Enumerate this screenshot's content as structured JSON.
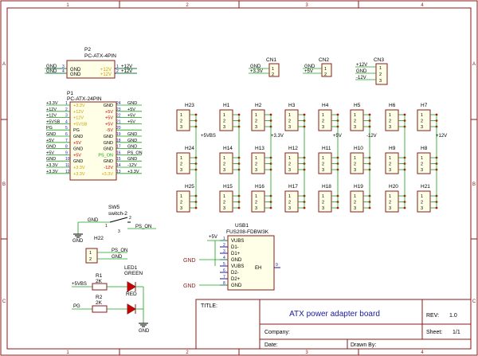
{
  "frame": {
    "col_labels": [
      "1",
      "2",
      "3",
      "4"
    ],
    "row_labels": [
      "A",
      "B",
      "C"
    ]
  },
  "title_block": {
    "title_label": "TITLE:",
    "title": "ATX power adapter board",
    "rev_label": "REV:",
    "rev": "1.0",
    "company_label": "Company:",
    "company": "",
    "sheet_label": "Sheet:",
    "sheet": "1/1",
    "date_label": "Date:",
    "date": "",
    "drawn_label": "Drawn By:",
    "drawn": ""
  },
  "p2": {
    "ref": "P2",
    "value": "PC-ATX-4PIN",
    "left_labels": [
      "GND",
      "GND"
    ],
    "right_labels": [
      "+12V",
      "+12V"
    ],
    "left_nets": [
      "GND",
      "GND"
    ],
    "right_nets": [
      "+12V",
      "+12V"
    ],
    "left_nums": [
      "3",
      "4"
    ],
    "right_nums": [
      "1",
      "2"
    ]
  },
  "p1": {
    "ref": "P1",
    "value": "PC-ATX-24PIN",
    "left_nums": [
      "1",
      "2",
      "3",
      "4",
      "5",
      "6",
      "7",
      "8",
      "9",
      "10",
      "11",
      "12"
    ],
    "right_nums": [
      "24",
      "23",
      "22",
      "21",
      "20",
      "19",
      "18",
      "17",
      "16",
      "15",
      "14",
      "13"
    ],
    "left_labels": [
      "+3.3V",
      "+12V",
      "+12V",
      "+5VSB",
      "PG",
      "GND",
      "+5V",
      "GND",
      "+5V",
      "GND",
      "+3.3V",
      "+3.3V"
    ],
    "right_labels": [
      "GND",
      "+5V",
      "+5V",
      "+5V",
      "-5V",
      "GND",
      "GND",
      "GND",
      "PS_ON",
      "GND",
      "-12V",
      "+3.3V"
    ],
    "left_nets": [
      "+3.3V",
      "+12V",
      "+12V",
      "+5VSB",
      "PG",
      "GND",
      "+5V",
      "GND",
      "+5V",
      "GND",
      "+3.3V",
      "+3.3V"
    ],
    "right_nets": [
      "GND",
      "+5V",
      "+5V",
      "+5V",
      "",
      "GND",
      "GND",
      "GND",
      "PS_ON",
      "GND",
      "-12V",
      "+3.3V"
    ]
  },
  "cn1": {
    "ref": "CN1",
    "pins": [
      "1",
      "2"
    ],
    "nets": [
      "GND",
      "+3.3V"
    ]
  },
  "cn2": {
    "ref": "CN2",
    "pins": [
      "1",
      "2"
    ],
    "nets": [
      "GND",
      "+5V"
    ]
  },
  "cn3": {
    "ref": "CN3",
    "pins": [
      "1",
      "2",
      "3"
    ],
    "nets": [
      "+12V",
      "GND",
      "-12V"
    ]
  },
  "headers": {
    "row1": [
      "H23",
      "H1",
      "H2",
      "H3",
      "H4",
      "H5",
      "H6",
      "H7"
    ],
    "row2": [
      "H24",
      "H14",
      "H13",
      "H12",
      "H11",
      "H10",
      "H9",
      "H8"
    ],
    "row3": [
      "H25",
      "H15",
      "H16",
      "H17",
      "H18",
      "H19",
      "H20",
      "H21"
    ],
    "pins": [
      "1",
      "2",
      "3"
    ]
  },
  "rail_labels": [
    "+5VBS",
    "+3.3V",
    "+5V",
    "-12V",
    "+12V"
  ],
  "sw5": {
    "ref": "SW5",
    "value": "switch-2",
    "net_left": "GND",
    "net_right": "PS_ON",
    "pins": [
      "1",
      "2",
      "3"
    ],
    "gnd": "GND"
  },
  "h22": {
    "ref": "H22",
    "nets": [
      "PS_ON",
      "GND"
    ],
    "pins": [
      "1",
      "2"
    ]
  },
  "leds": {
    "led1_ref": "LED1",
    "led1_value": "GREEN",
    "led2_value": "RED",
    "r1_ref": "R1",
    "r1_value": "2K",
    "r2_ref": "R2",
    "r2_value": "2K",
    "r1_net": "+5VBS",
    "r2_net": "PG",
    "gnd": "GND"
  },
  "usb1": {
    "ref": "USB1",
    "value": "FUS208-FDBW3K",
    "pins_left": [
      "VUBS",
      "D1-",
      "D1+",
      "GND",
      "VUBS",
      "D2-",
      "D2+",
      "GND"
    ],
    "pin_nums_left": [
      "1",
      "2",
      "3",
      "4",
      "5",
      "6",
      "7",
      "8"
    ],
    "pin_right": "EH",
    "pin_right_num": "9",
    "net": "+5V",
    "gnd_labels": [
      "GND",
      "GND"
    ]
  },
  "colors": {
    "frame": "#8b1a1a",
    "wire": "#16a016",
    "pin": "#1a1aa0",
    "text": "#000000",
    "yellow": "#c8a000",
    "red": "#cc0000",
    "net_name": "#1a1aa0"
  }
}
